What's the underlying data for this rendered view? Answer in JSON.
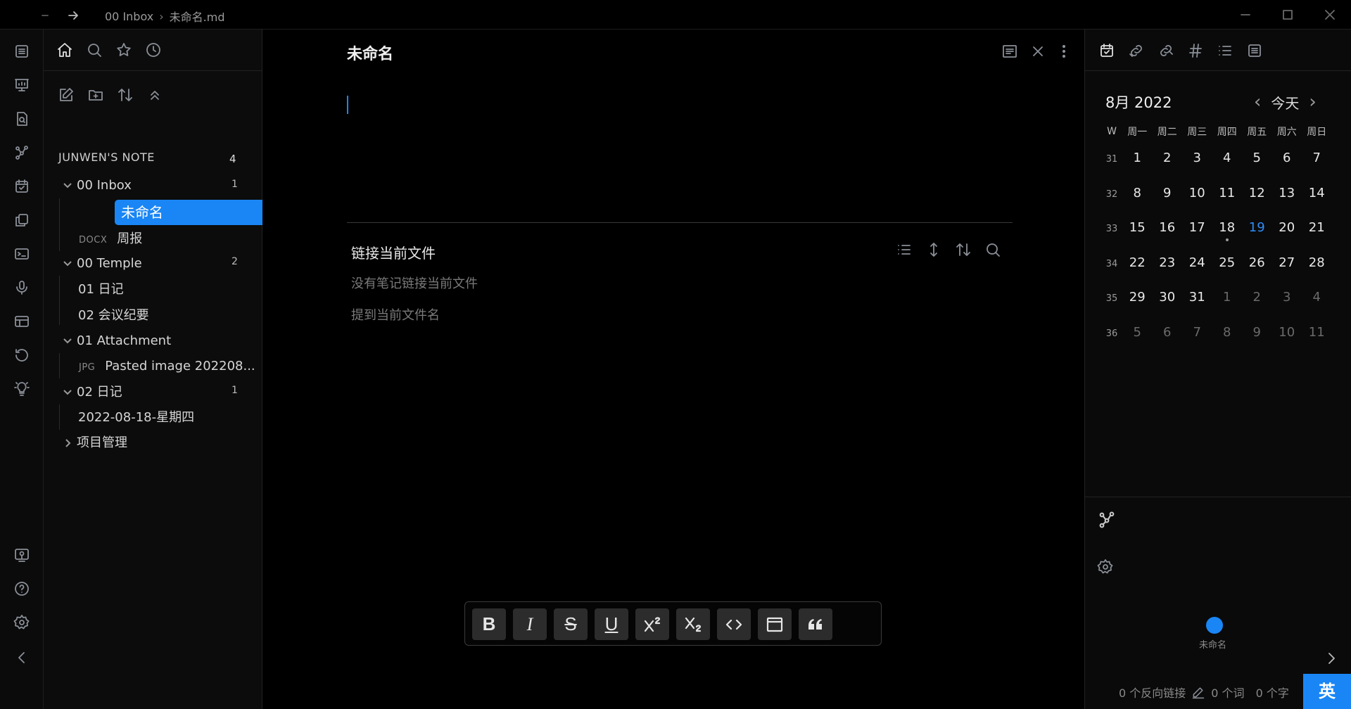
{
  "titlebar": {
    "breadcrumb_folder": "00 Inbox",
    "breadcrumb_sep": "›",
    "breadcrumb_file": "未命名.md"
  },
  "explorer": {
    "vault_name": "JUNWEN'S NOTE",
    "vault_count": "4",
    "tree": {
      "inbox": {
        "label": "00 Inbox",
        "count": "1"
      },
      "active_file": "未命名",
      "docx_tag": "DOCX",
      "weekly": "周报",
      "temple": {
        "label": "00 Temple",
        "count": "2"
      },
      "diary_tpl": "01 日记",
      "meeting_tpl": "02 会议纪要",
      "attachment": {
        "label": "01 Attachment"
      },
      "jpg_tag": "JPG",
      "pasted": "Pasted image 202208...",
      "diary": {
        "label": "02 日记",
        "count": "1"
      },
      "diary_entry": "2022-08-18-星期四",
      "projects": {
        "label": "项目管理"
      }
    }
  },
  "editor": {
    "title": "未命名",
    "backlinks_title": "链接当前文件",
    "no_links": "没有笔记链接当前文件",
    "mentions": "提到当前文件名"
  },
  "toolbar": {
    "bold": "B",
    "italic": "I",
    "strike": "S",
    "underline": "U"
  },
  "calendar": {
    "title": "8月 2022",
    "today_label": "今天",
    "prev": "‹",
    "next": "›",
    "week_header": "W",
    "weekdays": [
      "周一",
      "周二",
      "周三",
      "周四",
      "周五",
      "周六",
      "周日"
    ],
    "weeks": [
      {
        "wk": "31",
        "days": [
          "1",
          "2",
          "3",
          "4",
          "5",
          "6",
          "7"
        ]
      },
      {
        "wk": "32",
        "days": [
          "8",
          "9",
          "10",
          "11",
          "12",
          "13",
          "14"
        ]
      },
      {
        "wk": "33",
        "days": [
          "15",
          "16",
          "17",
          "18",
          "19",
          "20",
          "21"
        ]
      },
      {
        "wk": "34",
        "days": [
          "22",
          "23",
          "24",
          "25",
          "26",
          "27",
          "28"
        ]
      },
      {
        "wk": "35",
        "days": [
          "29",
          "30",
          "31",
          "1",
          "2",
          "3",
          "4"
        ]
      },
      {
        "wk": "36",
        "days": [
          "5",
          "6",
          "7",
          "8",
          "9",
          "10",
          "11"
        ]
      }
    ],
    "today_color": "#2f8df8"
  },
  "graph": {
    "node_label": "未命名",
    "node_color": "#1a86f5"
  },
  "statusbar": {
    "backlinks": "0 个反向链接",
    "words": "0 个词",
    "chars": "0 个字",
    "ime": "英"
  },
  "colors": {
    "accent": "#1a86f5",
    "background": "#000000"
  }
}
